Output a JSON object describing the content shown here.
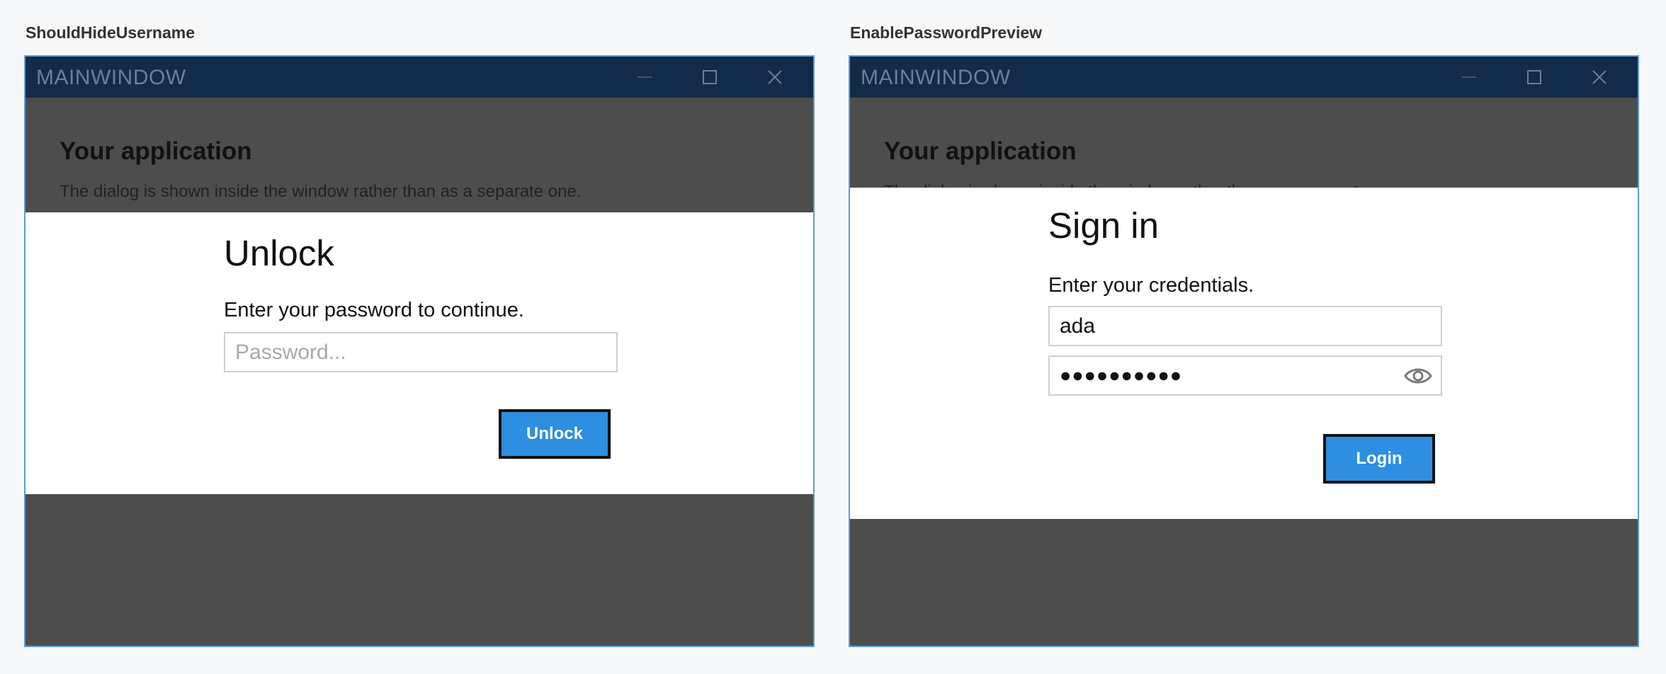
{
  "left": {
    "panel_label": "ShouldHideUsername",
    "window_title": "MAINWINDOW",
    "app_heading": "Your application",
    "app_text": "The dialog is shown inside the window rather than as a separate one.",
    "dialog": {
      "title": "Unlock",
      "message": "Enter your password to continue.",
      "password_placeholder": "Password...",
      "button_label": "Unlock"
    }
  },
  "right": {
    "panel_label": "EnablePasswordPreview",
    "window_title": "MAINWINDOW",
    "app_heading": "Your application",
    "app_text": "The dialog is shown inside the window rather than as a separate one.",
    "dialog": {
      "title": "Sign in",
      "message": "Enter your credentials.",
      "username_value": "ada",
      "password_masked": "●●●●●●●●●●",
      "button_label": "Login"
    }
  },
  "icons": {
    "minimize": "minimize-icon",
    "maximize": "maximize-icon",
    "close": "close-icon",
    "preview": "eye-icon"
  },
  "colors": {
    "titlebar": "#122b48",
    "overlay": "#4d4d4d",
    "accent_button": "#2e8ee0",
    "window_border": "#5b9bd5"
  }
}
